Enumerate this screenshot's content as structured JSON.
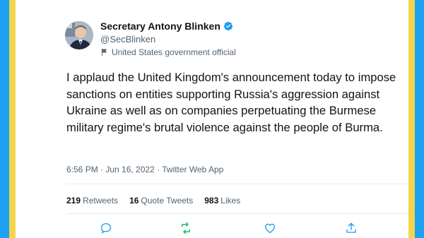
{
  "author": {
    "display_name": "Secretary Antony Blinken",
    "handle": "@SecBlinken",
    "label": "United States government official"
  },
  "tweet": {
    "text": "I applaud the United Kingdom's announcement today to impose sanctions on entities supporting Russia's aggression against Ukraine as well as on companies perpetuating the Burmese military regime's brutal violence against the people of Burma.",
    "timestamp": "6:56 PM · Jun 16, 2022 · Twitter Web App"
  },
  "stats": {
    "retweets_count": "219",
    "retweets_label": "Retweets",
    "quotes_count": "16",
    "quotes_label": "Quote Tweets",
    "likes_count": "983",
    "likes_label": "Likes"
  },
  "colors": {
    "background_blue": "#1da1f2",
    "frame_yellow": "#f2d54a",
    "verified_blue": "#1d9bf0",
    "retweet_green": "#17bf63",
    "icon_blue": "#1d9bf0"
  },
  "icons": {
    "reply": "reply-icon",
    "retweet": "retweet-icon",
    "like": "like-icon",
    "share": "share-icon",
    "verified": "verified-badge-icon",
    "label": "flag-icon"
  }
}
